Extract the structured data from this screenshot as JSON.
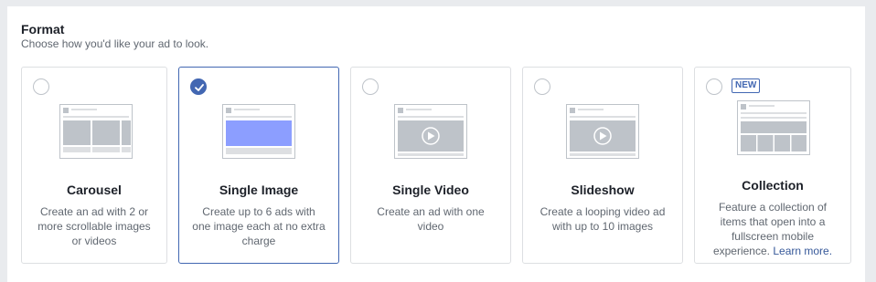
{
  "section": {
    "title": "Format",
    "subtitle": "Choose how you'd like your ad to look."
  },
  "cards": [
    {
      "title": "Carousel",
      "description": "Create an ad with 2 or more scrollable images or videos",
      "selected": false
    },
    {
      "title": "Single Image",
      "description": "Create up to 6 ads with one image each at no extra charge",
      "selected": true
    },
    {
      "title": "Single Video",
      "description": "Create an ad with one video",
      "selected": false
    },
    {
      "title": "Slideshow",
      "description": "Create a looping video ad with up to 10 images",
      "selected": false
    },
    {
      "title": "Collection",
      "description": "Feature a collection of items that open into a fullscreen mobile experience.",
      "link": "Learn more.",
      "badge": "NEW",
      "selected": false
    }
  ],
  "colors": {
    "accent": "#4267b2",
    "image_fill": "#8c9eff",
    "placeholder": "#bec3c9"
  },
  "icons": {
    "check": "check-icon",
    "play": "play-icon"
  }
}
